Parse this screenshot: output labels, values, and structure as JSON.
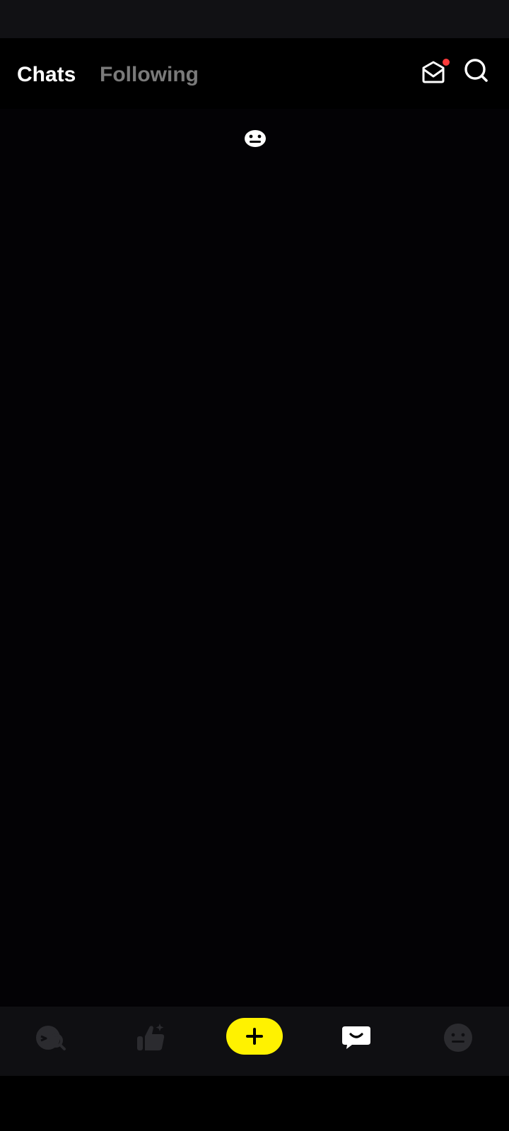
{
  "tabs": [
    {
      "label": "Chats",
      "active": true
    },
    {
      "label": "Following",
      "active": false
    }
  ],
  "header_icons": [
    "inbox-icon",
    "search-icon"
  ],
  "notification_dot_color": "#ff3b3b",
  "accent_color": "#fff200",
  "bottom_nav": [
    {
      "icon": "discover-search-icon",
      "active": false
    },
    {
      "icon": "thumbs-up-sparkle-icon",
      "active": false
    },
    {
      "icon": "plus-icon",
      "active": false
    },
    {
      "icon": "chat-bubble-smile-icon",
      "active": true
    },
    {
      "icon": "profile-face-icon",
      "active": false
    }
  ]
}
